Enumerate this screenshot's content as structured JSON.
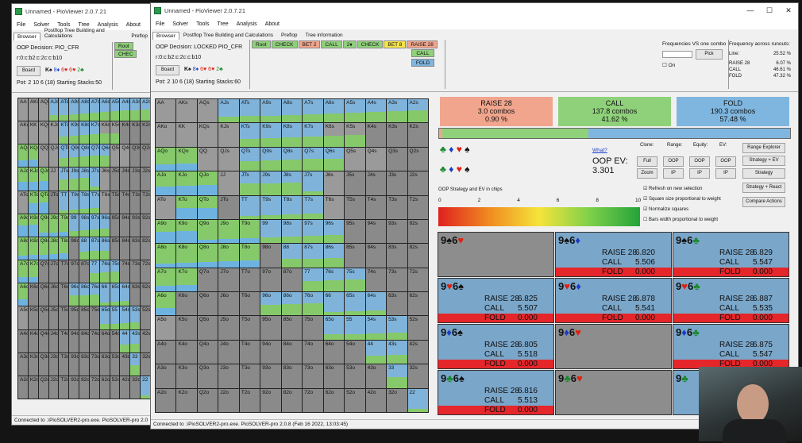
{
  "win1": {
    "title": "Unnamed - PioViewer 2.0.7.21",
    "menu": [
      "File",
      "Solver",
      "Tools",
      "Tree",
      "Analysis",
      "About"
    ],
    "tabs": [
      "Browser",
      "Postflop Tree Building and Calculations",
      "Preflop"
    ],
    "decision": "OOP Decision:  PIO_CFR",
    "board_text": "r:0:c:b2:c:2c:c:b10",
    "board_btn": "Board",
    "pot": "Pot: 2 10 6 (18) Starting Stacks:50",
    "root_chip": "Root",
    "check_chip": "CHEC",
    "status": "Connected to .\\PioSOLVER2-pro.exe. PioSOLVER-pro 2.0"
  },
  "win2": {
    "title": "Unnamed - PioViewer 2.0.7.21",
    "menu": [
      "File",
      "Solver",
      "Tools",
      "Tree",
      "Analysis",
      "About"
    ],
    "tabs": [
      "Browser",
      "Postflop Tree Building and Calculations",
      "Preflop",
      "Tree information"
    ],
    "decision": "OOP Decision:  LOCKED PIO_CFR",
    "board_text": "r:0:c:b2:c:2c:c:b10",
    "board_btn": "Board",
    "pot": "Pot: 2 10 6 (18) Starting Stacks:60",
    "action_chips": [
      {
        "label": "Root",
        "color": "#8fd17a"
      },
      {
        "label": "CHECK",
        "color": "#8fd17a"
      },
      {
        "label": "BET 2",
        "color": "#f1a58d"
      },
      {
        "label": "CALL",
        "color": "#8fd17a"
      },
      {
        "label": "2♦",
        "color": "#8fd17a"
      },
      {
        "label": "CHECK",
        "color": "#8fd17a"
      },
      {
        "label": "BET 8",
        "color": "#f5e34a"
      },
      {
        "label": "RAISE 28",
        "color": "#f1a58d"
      }
    ],
    "sub_chips": [
      {
        "label": "CALL",
        "color": "#8fd17a"
      },
      {
        "label": "FOLD",
        "color": "#7fb6e0"
      }
    ],
    "freq_label": "Frequencies VS one combo",
    "pick_btn": "Pick",
    "on_label": "On",
    "freq_runouts": "Frequency across runouts:",
    "runout_rows": [
      {
        "name": "Line:",
        "value": "25.52 %"
      },
      {
        "name": "RAISE 28",
        "value": "6.07 %"
      },
      {
        "name": "CALL",
        "value": "46.61 %"
      },
      {
        "name": "FOLD",
        "value": "47.32 %"
      }
    ],
    "status": "Connected to .\\PioSOLVER2-pro.exe. PioSOLVER-pro 2.0.8 (Feb 16 2022, 13:03:45)"
  },
  "stats": [
    {
      "name": "RAISE 28",
      "combos": "3.0 combos",
      "pct": "0.90 %",
      "color": "#f1a58d"
    },
    {
      "name": "CALL",
      "combos": "137.8 combos",
      "pct": "41.62 %",
      "color": "#8fd17a"
    },
    {
      "name": "FOLD",
      "combos": "190.3 combos",
      "pct": "57.48 %",
      "color": "#7fb6e0"
    }
  ],
  "strategy_bar": {
    "raise": 0.009,
    "call": 0.4162,
    "fold": 0.5748
  },
  "panel": {
    "what": "What?",
    "ev_label": "OOP EV:",
    "ev_value": "3.301",
    "clone": "Clone:",
    "range": "Range:",
    "equity": "Equity:",
    "ev": "EV:",
    "btn_full": "Full",
    "btn_oop1": "OOP",
    "btn_oop2": "OOP",
    "btn_oop3": "OOP",
    "btn_zoom": "Zoom",
    "btn_ip1": "IP",
    "btn_ip2": "IP",
    "btn_ip3": "IP",
    "range_explorer": "Range Explorer",
    "strategy_ev": "Strategy + EV",
    "strategy": "Strategy",
    "strategy_react": "Strategy + React",
    "compare": "Compare Actions",
    "chk_refresh": "Refresh on new selection",
    "chk_square": "Square size proportional to weight",
    "chk_normalize": "Normalize squares",
    "chk_bars": "Bars width proportional to weight",
    "chips_label": "OOP Strategy and EV in chips",
    "scale": [
      "0",
      "2",
      "4",
      "6",
      "8",
      "10"
    ]
  },
  "ranks": [
    "A",
    "K",
    "Q",
    "J",
    "T",
    "9",
    "8",
    "7",
    "6",
    "5",
    "4",
    "3",
    "2"
  ],
  "combos": [
    {
      "title": "9♠6♥",
      "raise": "",
      "call": "",
      "fold": "",
      "grey": true
    },
    {
      "title": "9♠6♦",
      "raise": "6.820",
      "call": "5.506",
      "fold": "0.000"
    },
    {
      "title": "9♠6♣",
      "raise": "6.829",
      "call": "5.547",
      "fold": "0.000"
    },
    {
      "title": "9♥6♠",
      "raise": "6.825",
      "call": "5.507",
      "fold": "0.000"
    },
    {
      "title": "9♥6♦",
      "raise": "6.878",
      "call": "5.541",
      "fold": "0.000"
    },
    {
      "title": "9♥6♣",
      "raise": "6.887",
      "call": "5.535",
      "fold": "0.000"
    },
    {
      "title": "9♦6♠",
      "raise": "6.805",
      "call": "5.518",
      "fold": "0.000"
    },
    {
      "title": "9♦6♥",
      "raise": "",
      "call": "",
      "fold": "",
      "grey": true
    },
    {
      "title": "9♦6♣",
      "raise": "6.875",
      "call": "5.547",
      "fold": "0.000"
    },
    {
      "title": "9♣6♠",
      "raise": "6.816",
      "call": "5.513",
      "fold": "0.000"
    },
    {
      "title": "9♣6♥",
      "raise": "",
      "call": "",
      "fold": "",
      "grey": true
    },
    {
      "title": "9♣",
      "raise": "",
      "call": "",
      "fold": "",
      "partial": true
    }
  ],
  "combo_labels": {
    "raise": "RAISE 28",
    "call": "CALL",
    "fold": "FOLD"
  }
}
